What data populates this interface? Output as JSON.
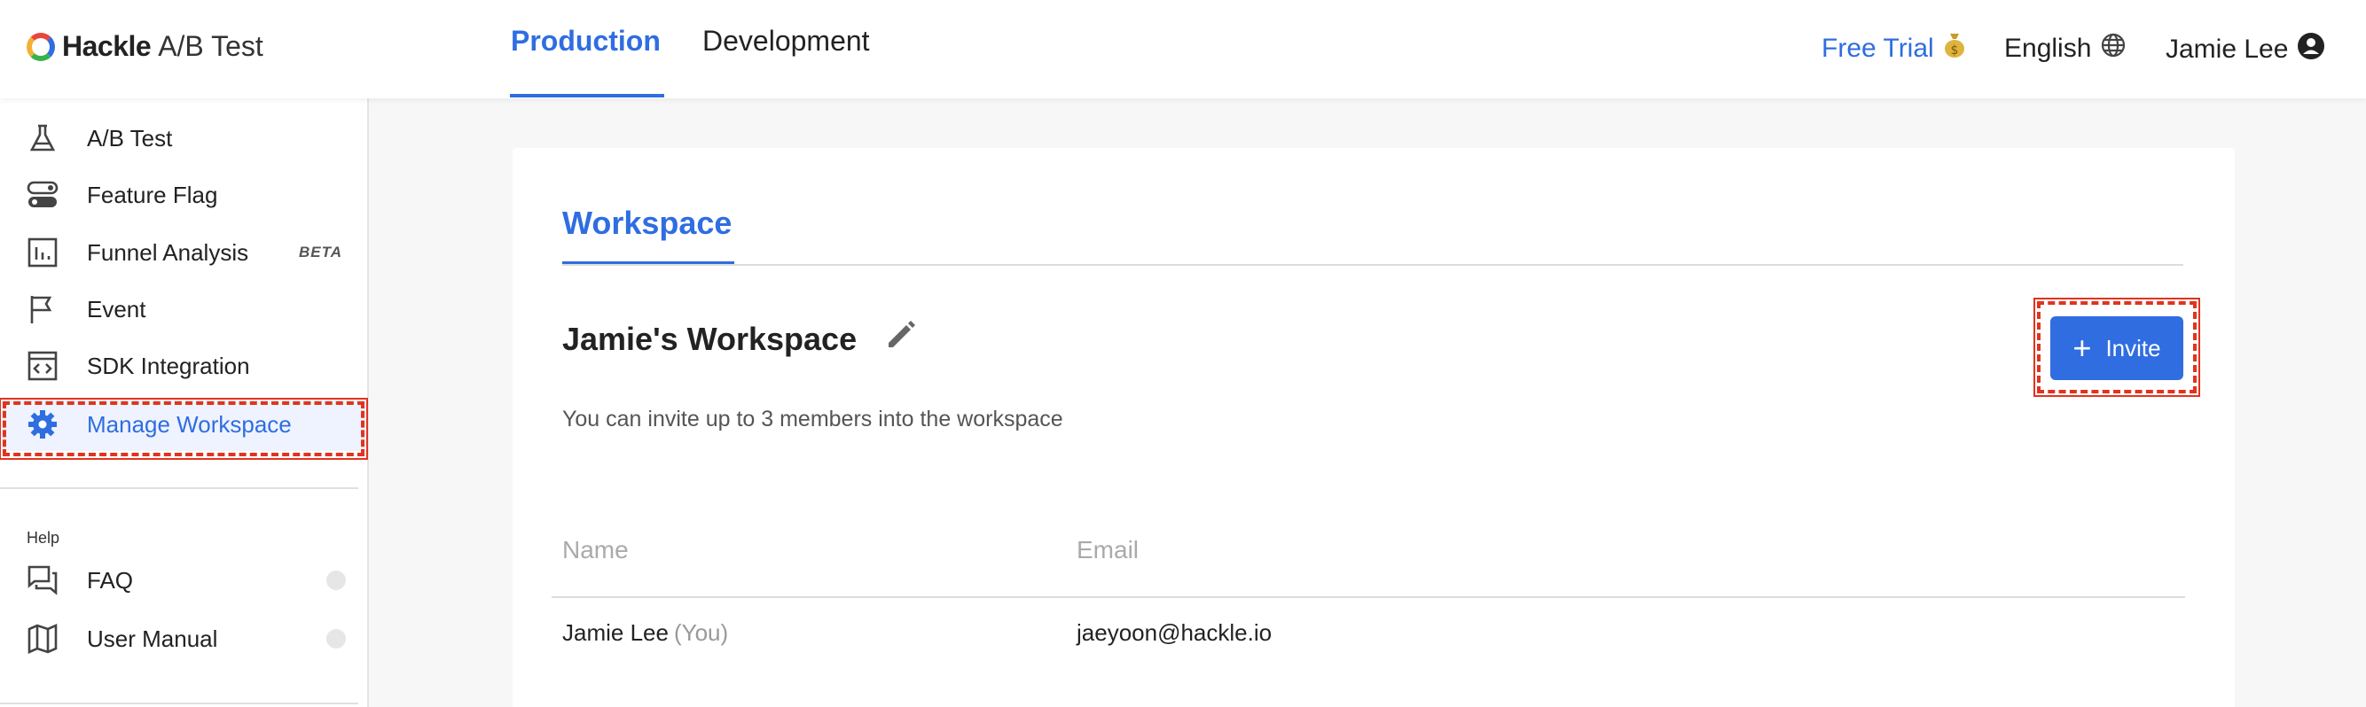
{
  "header": {
    "logo_brand": "Hackle",
    "logo_product": "A/B Test",
    "env_tabs": [
      {
        "label": "Production",
        "active": true
      },
      {
        "label": "Development",
        "active": false
      }
    ],
    "free_trial": "Free Trial",
    "free_trial_icon": "money-bag-icon",
    "language": "English",
    "language_icon": "globe-icon",
    "user_name": "Jamie Lee",
    "user_icon": "account-circle-icon"
  },
  "sidebar": {
    "items": [
      {
        "label": "A/B Test",
        "icon": "flask-icon"
      },
      {
        "label": "Feature Flag",
        "icon": "toggle-icon"
      },
      {
        "label": "Funnel Analysis",
        "icon": "bar-chart-icon",
        "badge": "BETA"
      },
      {
        "label": "Event",
        "icon": "flag-icon"
      },
      {
        "label": "SDK Integration",
        "icon": "code-window-icon"
      },
      {
        "label": "Manage Workspace",
        "icon": "gear-icon",
        "active": true
      }
    ],
    "help_label": "Help",
    "help_items": [
      {
        "label": "FAQ",
        "icon": "chat-icon"
      },
      {
        "label": "User Manual",
        "icon": "map-icon"
      }
    ]
  },
  "main": {
    "tab_label": "Workspace",
    "workspace_title": "Jamie's Workspace",
    "description": "You can invite up to 3 members into the workspace",
    "invite_label": "Invite",
    "table": {
      "columns": [
        "Name",
        "Email"
      ],
      "rows": [
        {
          "name": "Jamie Lee",
          "tag": "(You)",
          "email": "jaeyoon@hackle.io"
        }
      ]
    }
  },
  "colors": {
    "accent": "#2f6de1",
    "highlight": "#e0341f"
  }
}
